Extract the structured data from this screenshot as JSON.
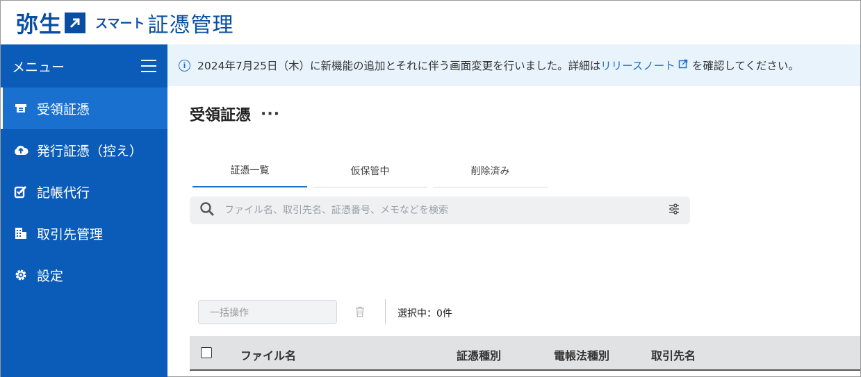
{
  "header": {
    "brand": "弥生",
    "product_small": "スマート",
    "product_big": "証憑管理",
    "brand_color": "#0a4ea1"
  },
  "sidebar": {
    "menu_label": "メニュー",
    "items": [
      {
        "label": "受領証憑",
        "icon": "receipt-icon",
        "active": true
      },
      {
        "label": "発行証憑（控え）",
        "icon": "upload-cloud-icon",
        "active": false
      },
      {
        "label": "記帳代行",
        "icon": "edit-check-icon",
        "active": false
      },
      {
        "label": "取引先管理",
        "icon": "building-icon",
        "active": false
      },
      {
        "label": "設定",
        "icon": "gear-icon",
        "active": false
      }
    ]
  },
  "notice": {
    "text_before": "2024年7月25日（木）に新機能の追加とそれに伴う画面変更を行いました。詳細は",
    "link_text": "リリースノート",
    "text_after": "を確認してください。"
  },
  "page": {
    "title": "受領証憑",
    "more": "···"
  },
  "tabs": [
    {
      "label": "証憑一覧",
      "active": true
    },
    {
      "label": "仮保管中",
      "active": false
    },
    {
      "label": "削除済み",
      "active": false
    }
  ],
  "search": {
    "placeholder": "ファイル名、取引先名、証憑番号、メモなどを検索",
    "value": ""
  },
  "toolbar": {
    "bulk_label": "一括操作",
    "selected_text": "選択中：0件"
  },
  "table": {
    "columns": [
      "ファイル名",
      "証憑種別",
      "電帳法種別",
      "取引先名"
    ]
  }
}
